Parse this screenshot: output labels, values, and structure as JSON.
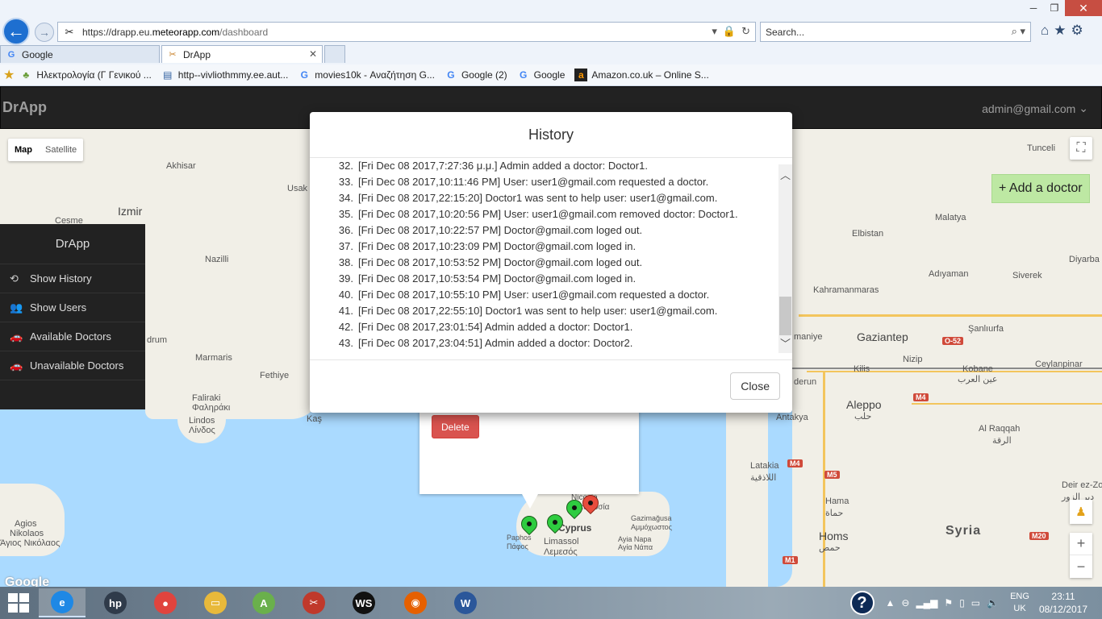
{
  "browser": {
    "url_scheme": "https://",
    "url_host_sub": "drapp.eu.",
    "url_host_main": "meteorapp.com",
    "url_path": "/dashboard",
    "search_placeholder": "Search...",
    "tabs": [
      {
        "icon": "G",
        "label": "Google",
        "active": false
      },
      {
        "icon": "✂",
        "label": "DrApp",
        "active": true
      }
    ],
    "favorites": [
      {
        "icon": "♣",
        "label": "Ηλεκτρολογία (Γ Γενικού ..."
      },
      {
        "icon": "▤",
        "label": "http--vivliothmmy.ee.aut..."
      },
      {
        "icon": "G",
        "label": "movies10k - Αναζήτηση G..."
      },
      {
        "icon": "G",
        "label": "Google (2)"
      },
      {
        "icon": "G",
        "label": "Google"
      },
      {
        "icon": "a",
        "label": "Amazon.co.uk – Online S..."
      }
    ]
  },
  "navbar": {
    "brand": "DrApp",
    "user": "admin@gmail.com"
  },
  "map": {
    "type_buttons": [
      "Map",
      "Satellite"
    ],
    "add_doctor_label": "+ Add a doctor",
    "delete_label": "Delete",
    "logo": "Google",
    "labels": [
      {
        "text": "Tunceli",
        "cls": ""
      },
      {
        "text": "Akhisar",
        "cls": ""
      },
      {
        "text": "Usak",
        "cls": ""
      },
      {
        "text": "Izmir",
        "cls": "big"
      },
      {
        "text": "Cesme",
        "cls": ""
      },
      {
        "text": "Nazilli",
        "cls": ""
      },
      {
        "text": "Malatya",
        "cls": ""
      },
      {
        "text": "Elbistan",
        "cls": ""
      },
      {
        "text": "Diyarba",
        "cls": ""
      },
      {
        "text": "Adıyaman",
        "cls": ""
      },
      {
        "text": "Siverek",
        "cls": ""
      },
      {
        "text": "Kahramanmaras",
        "cls": ""
      },
      {
        "text": "Gaziantep",
        "cls": "big"
      },
      {
        "text": "Şanlıurfa",
        "cls": ""
      },
      {
        "text": "maniye",
        "cls": ""
      },
      {
        "text": "Kilis",
        "cls": ""
      },
      {
        "text": "Nizip",
        "cls": ""
      },
      {
        "text": "Kobane",
        "cls": ""
      },
      {
        "text": "عين العرب",
        "cls": ""
      },
      {
        "text": "Ceylanpinar",
        "cls": ""
      },
      {
        "text": "derun",
        "cls": ""
      },
      {
        "text": "Aleppo",
        "cls": "big"
      },
      {
        "text": "حلب",
        "cls": ""
      },
      {
        "text": "Antakya",
        "cls": ""
      },
      {
        "text": "Al Raqqah",
        "cls": ""
      },
      {
        "text": "الرقة",
        "cls": ""
      },
      {
        "text": "Latakia",
        "cls": ""
      },
      {
        "text": "اللاذقية",
        "cls": ""
      },
      {
        "text": "Hama",
        "cls": ""
      },
      {
        "text": "حماة",
        "cls": ""
      },
      {
        "text": "Homs",
        "cls": "big"
      },
      {
        "text": "حمص",
        "cls": ""
      },
      {
        "text": "Syria",
        "cls": "country"
      },
      {
        "text": "Deir ez-Zo",
        "cls": ""
      },
      {
        "text": "دير الزور",
        "cls": ""
      },
      {
        "text": "drum",
        "cls": ""
      },
      {
        "text": "Marmaris",
        "cls": ""
      },
      {
        "text": "Fethiye",
        "cls": ""
      },
      {
        "text": "Faliraki",
        "cls": ""
      },
      {
        "text": "Φαληράκι",
        "cls": ""
      },
      {
        "text": "Lindos",
        "cls": ""
      },
      {
        "text": "Λίνδος",
        "cls": ""
      },
      {
        "text": "Kaş",
        "cls": ""
      },
      {
        "text": "Agios",
        "cls": ""
      },
      {
        "text": "Nikolaos",
        "cls": ""
      },
      {
        "text": "Άγιος Νικόλαος",
        "cls": ""
      },
      {
        "text": "Paphos",
        "cls": ""
      },
      {
        "text": "Πάφος",
        "cls": ""
      },
      {
        "text": "Limassol",
        "cls": ""
      },
      {
        "text": "Λεμεσός",
        "cls": ""
      },
      {
        "text": "Cyprus",
        "cls": "big"
      },
      {
        "text": "Gazimağusa",
        "cls": ""
      },
      {
        "text": "Αμμόχωστος",
        "cls": ""
      },
      {
        "text": "Ayia Napa",
        "cls": ""
      },
      {
        "text": "Αγία Νάπα",
        "cls": ""
      },
      {
        "text": "Nicosia",
        "cls": ""
      },
      {
        "text": "Λευκωσία",
        "cls": ""
      }
    ],
    "shields": [
      "O-52",
      "M4",
      "M4",
      "M5",
      "M5",
      "M1",
      "M20"
    ]
  },
  "sidebar": {
    "title": "DrApp",
    "items": [
      {
        "icon": "⟲",
        "label": "Show History"
      },
      {
        "icon": "👥",
        "label": "Show Users"
      },
      {
        "icon": "🚗",
        "label": "Available Doctors"
      },
      {
        "icon": "🚗",
        "label": "Unavailable Doctors"
      }
    ]
  },
  "modal": {
    "title": "History",
    "close_label": "Close",
    "entries": [
      {
        "num": "32.",
        "text": "[Fri Dec 08 2017,7:27:36 μ.μ.] Admin added a doctor: Doctor1."
      },
      {
        "num": "33.",
        "text": "[Fri Dec 08 2017,10:11:46 PM] User: user1@gmail.com requested a doctor."
      },
      {
        "num": "34.",
        "text": "[Fri Dec 08 2017,22:15:20] Doctor1 was sent to help user: user1@gmail.com."
      },
      {
        "num": "35.",
        "text": "[Fri Dec 08 2017,10:20:56 PM] User: user1@gmail.com removed doctor: Doctor1."
      },
      {
        "num": "36.",
        "text": "[Fri Dec 08 2017,10:22:57 PM] Doctor@gmail.com loged out."
      },
      {
        "num": "37.",
        "text": "[Fri Dec 08 2017,10:23:09 PM] Doctor@gmail.com loged in."
      },
      {
        "num": "38.",
        "text": "[Fri Dec 08 2017,10:53:52 PM] Doctor@gmail.com loged out."
      },
      {
        "num": "39.",
        "text": "[Fri Dec 08 2017,10:53:54 PM] Doctor@gmail.com loged in."
      },
      {
        "num": "40.",
        "text": "[Fri Dec 08 2017,10:55:10 PM] User: user1@gmail.com requested a doctor."
      },
      {
        "num": "41.",
        "text": "[Fri Dec 08 2017,22:55:10] Doctor1 was sent to help user: user1@gmail.com."
      },
      {
        "num": "42.",
        "text": "[Fri Dec 08 2017,23:01:54] Admin added a doctor: Doctor1."
      },
      {
        "num": "43.",
        "text": "[Fri Dec 08 2017,23:04:51] Admin added a doctor: Doctor2."
      }
    ]
  },
  "taskbar": {
    "apps": [
      {
        "name": "internet-explorer",
        "glyph": "e",
        "color": "#1e88e5",
        "active": true
      },
      {
        "name": "hp",
        "glyph": "hp",
        "color": "#2f3b4a",
        "active": false
      },
      {
        "name": "chrome",
        "glyph": "●",
        "color": "#e0443e",
        "active": false
      },
      {
        "name": "file-explorer",
        "glyph": "▭",
        "color": "#e8b93b",
        "active": false
      },
      {
        "name": "android-studio",
        "glyph": "A",
        "color": "#6ab04c",
        "active": false
      },
      {
        "name": "snipping-tool",
        "glyph": "✂",
        "color": "#c0392b",
        "active": false
      },
      {
        "name": "webstorm",
        "glyph": "WS",
        "color": "#111111",
        "active": false
      },
      {
        "name": "firefox",
        "glyph": "◉",
        "color": "#e66000",
        "active": false
      },
      {
        "name": "word",
        "glyph": "W",
        "color": "#2b579a",
        "active": false
      }
    ],
    "lang_top": "ENG",
    "lang_bottom": "UK",
    "time": "23:11",
    "date": "08/12/2017"
  }
}
